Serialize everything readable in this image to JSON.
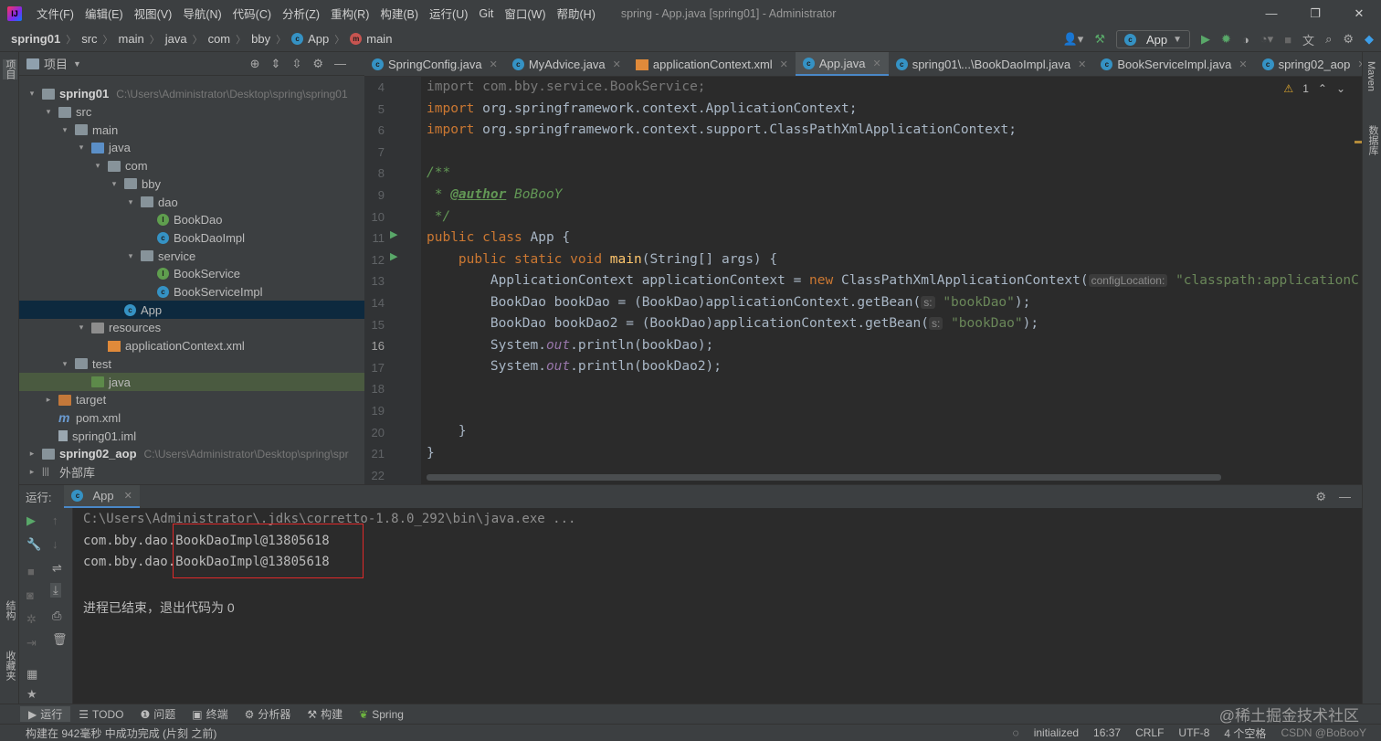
{
  "menubar": {
    "items": [
      "文件(F)",
      "编辑(E)",
      "视图(V)",
      "导航(N)",
      "代码(C)",
      "分析(Z)",
      "重构(R)",
      "构建(B)",
      "运行(U)",
      "Git",
      "窗口(W)",
      "帮助(H)"
    ],
    "window_title": "spring - App.java [spring01] - Administrator"
  },
  "navbar": {
    "crumbs": [
      "spring01",
      "src",
      "main",
      "java",
      "com",
      "bby",
      "App",
      "main"
    ],
    "run_config": "App"
  },
  "left_stripe": {
    "project": "项目",
    "structure": "结构",
    "favorites": "收藏夹"
  },
  "right_stripe": {
    "maven": "Maven",
    "database": "数据库"
  },
  "project_panel": {
    "title": "项目",
    "tree": [
      {
        "label": "spring01",
        "path": "C:\\Users\\Administrator\\Desktop\\spring\\spring01",
        "icon": "folder",
        "arrow": "▾",
        "bold": true
      },
      {
        "label": "src",
        "icon": "folder",
        "arrow": "▾"
      },
      {
        "label": "main",
        "icon": "folder",
        "arrow": "▾"
      },
      {
        "label": "java",
        "icon": "folder-blue",
        "arrow": "▾"
      },
      {
        "label": "com",
        "icon": "folder",
        "arrow": "▾"
      },
      {
        "label": "bby",
        "icon": "folder",
        "arrow": "▾"
      },
      {
        "label": "dao",
        "icon": "folder",
        "arrow": "▾"
      },
      {
        "label": "BookDao",
        "icon": "interface",
        "arrow": ""
      },
      {
        "label": "BookDaoImpl",
        "icon": "class",
        "arrow": ""
      },
      {
        "label": "service",
        "icon": "folder",
        "arrow": "▾"
      },
      {
        "label": "BookService",
        "icon": "interface",
        "arrow": ""
      },
      {
        "label": "BookServiceImpl",
        "icon": "class",
        "arrow": ""
      },
      {
        "label": "App",
        "icon": "class",
        "arrow": "",
        "selected": true
      },
      {
        "label": "resources",
        "icon": "folder-res",
        "arrow": "▾"
      },
      {
        "label": "applicationContext.xml",
        "icon": "xml",
        "arrow": ""
      },
      {
        "label": "test",
        "icon": "folder",
        "arrow": "▾"
      },
      {
        "label": "java",
        "icon": "folder-green",
        "arrow": "",
        "green": true
      },
      {
        "label": "target",
        "icon": "folder-orange",
        "arrow": "▸"
      },
      {
        "label": "pom.xml",
        "icon": "maven",
        "arrow": ""
      },
      {
        "label": "spring01.iml",
        "icon": "file",
        "arrow": ""
      },
      {
        "label": "spring02_aop",
        "path": "C:\\Users\\Administrator\\Desktop\\spring\\spr",
        "icon": "folder",
        "arrow": "▸",
        "bold": true
      },
      {
        "label": "外部库",
        "icon": "library",
        "arrow": "▸"
      },
      {
        "label": "草稿文件和控制台",
        "icon": "scratch",
        "arrow": "▸"
      }
    ]
  },
  "tabs": [
    {
      "label": "SpringConfig.java",
      "icon": "class"
    },
    {
      "label": "MyAdvice.java",
      "icon": "class"
    },
    {
      "label": "applicationContext.xml",
      "icon": "xml"
    },
    {
      "label": "App.java",
      "icon": "class",
      "active": true
    },
    {
      "label": "spring01\\...\\BookDaoImpl.java",
      "icon": "class"
    },
    {
      "label": "BookServiceImpl.java",
      "icon": "class"
    },
    {
      "label": "spring02_aop",
      "icon": "class"
    }
  ],
  "editor": {
    "warnings": "1",
    "line_numbers": [
      "4",
      "5",
      "6",
      "7",
      "8",
      "9",
      "10",
      "11",
      "12",
      "13",
      "14",
      "15",
      "16",
      "17",
      "18",
      "19",
      "20",
      "21",
      "22"
    ],
    "line4": "import com.bby.service.BookService;",
    "line5_kw": "import",
    "line5_rest": " org.springframework.context.ApplicationContext;",
    "line6_kw": "import",
    "line6_rest": " org.springframework.context.support.ClassPathXmlApplicationContext;",
    "line8": "/**",
    "line9_star": " * ",
    "line9_tag": "@author",
    "line9_rest": " BoBooY",
    "line10": " */",
    "line11_kw": "public class ",
    "line11_rest": "App {",
    "line12_kw": "    public static void ",
    "line12_fn": "main",
    "line12_rest": "(String[] args) {",
    "line13_a": "        ApplicationContext applicationContext = ",
    "line13_kw": "new",
    "line13_b": " ClassPathXmlApplicationContext(",
    "line13_hint": "configLocation:",
    "line13_str": "\"classpath:applicationC",
    "line14_a": "        BookDao bookDao = (BookDao)applicationContext.getBean(",
    "line14_hint": "s:",
    "line14_str": "\"bookDao\"",
    "line14_b": ");",
    "line15_a": "        BookDao bookDao2 = (BookDao)applicationContext.getBean(",
    "line15_hint": "s:",
    "line15_str": "\"bookDao\"",
    "line15_b": ");",
    "line16_a": "        System.",
    "line16_st": "out",
    "line16_b": ".println(bookDao);",
    "line17_a": "        System.",
    "line17_st": "out",
    "line17_b": ".println(bookDao2);",
    "line20": "    }",
    "line21": "}"
  },
  "run_panel": {
    "label": "运行:",
    "tab": "App",
    "cmd": "C:\\Users\\Administrator\\.jdks\\corretto-1.8.0_292\\bin\\java.exe ...",
    "out1_pre": "com.bby.dao.",
    "out1_post": "BookDaoImpl@13805618",
    "out2_pre": "com.bby.dao.",
    "out2_post": "BookDaoImpl@13805618",
    "exit": "进程已结束，退出代码为 0",
    "highlight_color": "#e0292a"
  },
  "toolwindows": [
    "运行",
    "TODO",
    "问题",
    "终端",
    "分析器",
    "构建",
    "Spring"
  ],
  "status": {
    "left": "构建在 942毫秒 中成功完成 (片刻 之前)",
    "initialized": "initialized",
    "position": "16:37",
    "line_sep": "CRLF",
    "encoding": "UTF-8",
    "indent": "4 个空格"
  },
  "watermark": {
    "site": "@稀土掘金技术社区",
    "csdn": "CSDN @BoBooY"
  },
  "colors": {
    "accent": "#4a88c7",
    "keyword": "#cc7832",
    "string": "#6a8759",
    "run_green": "#59a869"
  }
}
